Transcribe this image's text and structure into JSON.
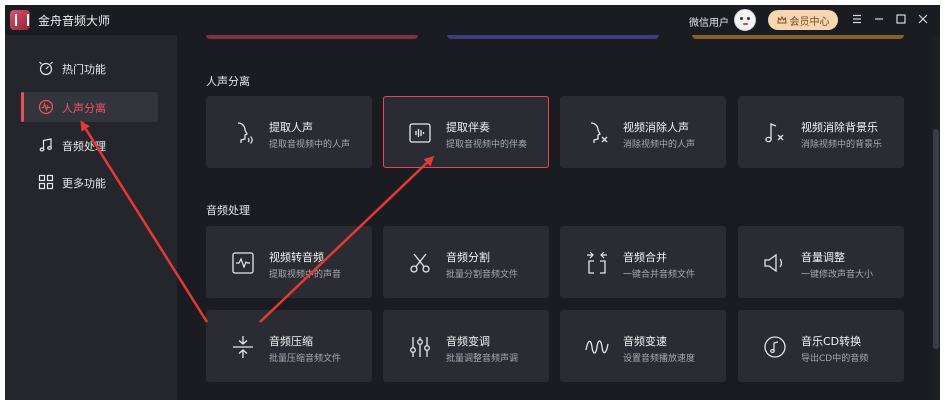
{
  "app": {
    "title": "金舟音频大师"
  },
  "header": {
    "user_name": "微信用户",
    "vip_label": "会员中心"
  },
  "sidebar": {
    "items": [
      {
        "label": "热门功能",
        "icon": "hot-icon",
        "active": false
      },
      {
        "label": "人声分离",
        "icon": "waveform-icon",
        "active": true
      },
      {
        "label": "音频处理",
        "icon": "music-note-icon",
        "active": false
      },
      {
        "label": "更多功能",
        "icon": "grid-icon",
        "active": false
      }
    ]
  },
  "sections": [
    {
      "title": "人声分离",
      "cards": [
        {
          "title": "提取人声",
          "subtitle": "提取音视频中的人声",
          "icon": "voice-head-icon",
          "selected": false
        },
        {
          "title": "提取伴奏",
          "subtitle": "提取音视频中的伴奏",
          "icon": "accompaniment-icon",
          "selected": true
        },
        {
          "title": "视频消除人声",
          "subtitle": "消除视频中的人声",
          "icon": "voice-remove-icon",
          "selected": false
        },
        {
          "title": "视频消除背景乐",
          "subtitle": "消除视频中的背景乐",
          "icon": "music-remove-icon",
          "selected": false
        }
      ]
    },
    {
      "title": "音频处理",
      "cards": [
        {
          "title": "视频转音频",
          "subtitle": "提取视频中的声音",
          "icon": "video-to-audio-icon",
          "selected": false
        },
        {
          "title": "音频分割",
          "subtitle": "批量分割音频文件",
          "icon": "scissors-icon",
          "selected": false
        },
        {
          "title": "音频合并",
          "subtitle": "一键合并音频文件",
          "icon": "merge-icon",
          "selected": false
        },
        {
          "title": "音量调整",
          "subtitle": "一键修改声音大小",
          "icon": "volume-icon",
          "selected": false
        },
        {
          "title": "音频压缩",
          "subtitle": "批量压缩音频文件",
          "icon": "compress-icon",
          "selected": false
        },
        {
          "title": "音频变调",
          "subtitle": "批量调整音频声调",
          "icon": "equalizer-icon",
          "selected": false
        },
        {
          "title": "音频变速",
          "subtitle": "设置音频播放速度",
          "icon": "wave-speed-icon",
          "selected": false
        },
        {
          "title": "音乐CD转换",
          "subtitle": "导出CD中的音频",
          "icon": "cd-icon",
          "selected": false
        }
      ]
    }
  ],
  "colors": {
    "accent": "#e8505f",
    "background": "#1b1c21",
    "sidebar": "#25262c",
    "card": "#2b2c33",
    "arrow": "#e53935",
    "vip": "#f6d7b2"
  }
}
